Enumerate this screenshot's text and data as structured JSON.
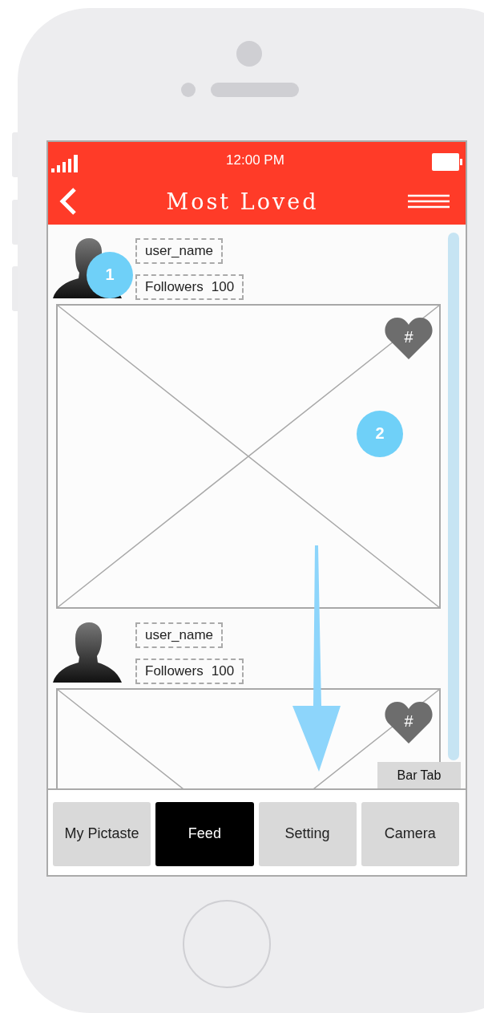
{
  "status_bar": {
    "time": "12:00 PM"
  },
  "nav": {
    "title": "Most Loved"
  },
  "posts": [
    {
      "username": "user_name",
      "followers_label": "Followers",
      "followers_count": "100",
      "heart_label": "#"
    },
    {
      "username": "user_name",
      "followers_label": "Followers",
      "followers_count": "100",
      "heart_label": "#"
    }
  ],
  "annotations": [
    "1",
    "2"
  ],
  "bar_tab_label": "Bar Tab",
  "tabs": [
    {
      "label": "My Pictaste",
      "selected": false
    },
    {
      "label": "Feed",
      "selected": true
    },
    {
      "label": "Setting",
      "selected": false
    },
    {
      "label": "Camera",
      "selected": false
    }
  ]
}
